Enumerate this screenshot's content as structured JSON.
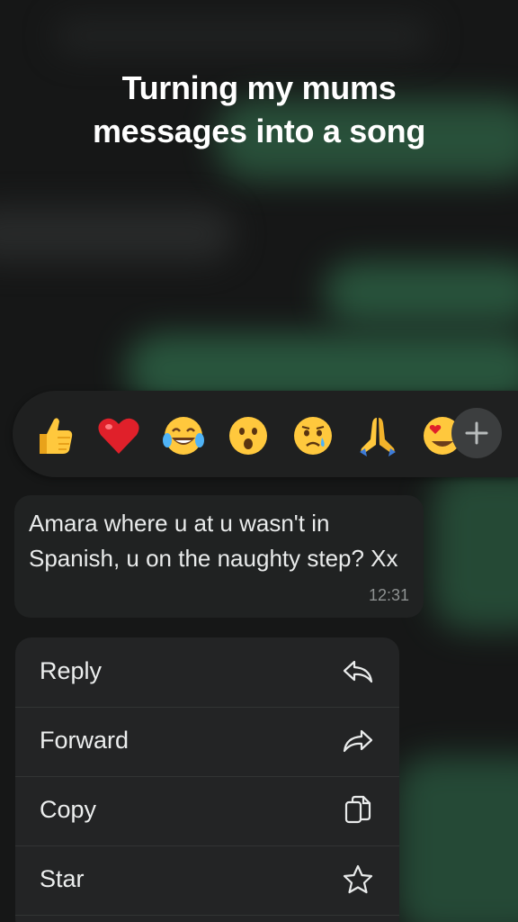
{
  "overlay": {
    "line1": "Turning my mums",
    "line2": "messages into a song"
  },
  "reactions": [
    {
      "name": "thumbs-up",
      "glyph": "👍"
    },
    {
      "name": "red-heart",
      "glyph": "❤"
    },
    {
      "name": "tears-of-joy",
      "glyph": "😂"
    },
    {
      "name": "surprised-face",
      "glyph": "😮"
    },
    {
      "name": "crying-face",
      "glyph": "😢"
    },
    {
      "name": "folded-hands",
      "glyph": "🙏"
    },
    {
      "name": "heart-eyes",
      "glyph": "😍"
    }
  ],
  "add_reaction_icon": "plus-icon",
  "message": {
    "text": "Amara where u at u wasn't in Spanish, u on the naughty step? Xx",
    "time": "12:31"
  },
  "menu": {
    "items": [
      {
        "label": "Reply",
        "icon": "reply-icon"
      },
      {
        "label": "Forward",
        "icon": "forward-icon"
      },
      {
        "label": "Copy",
        "icon": "copy-icon"
      },
      {
        "label": "Star",
        "icon": "star-icon"
      }
    ]
  },
  "colors": {
    "background": "#161717",
    "bubble": "#202222",
    "menu": "#232425",
    "blurred_green": "#2d6245"
  }
}
